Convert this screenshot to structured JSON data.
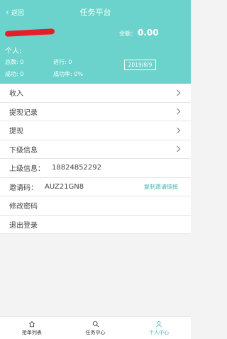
{
  "nav": {
    "back_label": "返回",
    "title": "任务平台"
  },
  "profile": {
    "balance_label": "余额：",
    "balance_value": "0.00",
    "personal_label": "个人:",
    "stats": {
      "total": "总数: 0",
      "in_progress": "进行: 0",
      "success": "成功: 0",
      "success_rate": "成功率: 0%"
    },
    "date": "2019/8/9"
  },
  "menu": {
    "income": "收入",
    "withdraw_records": "提现记录",
    "withdraw": "提现",
    "subordinate_info": "下级信息",
    "upline_label": "上级信息：",
    "upline_value": "18824852292",
    "invite_label": "邀请码：",
    "invite_value": "AUZ21GN8",
    "copy_invite_link": "复制邀请链接",
    "change_password": "修改密码",
    "logout": "退出登录"
  },
  "tabbar": {
    "tabs": [
      {
        "label": "抢单列表",
        "icon": "home-icon",
        "active": false
      },
      {
        "label": "任务中心",
        "icon": "search-icon",
        "active": false
      },
      {
        "label": "个人中心",
        "icon": "user-icon",
        "active": true
      }
    ]
  },
  "colors": {
    "accent": "#6bd3cc",
    "accent_dark": "#39b8ae",
    "redaction": "#e61e2a"
  }
}
